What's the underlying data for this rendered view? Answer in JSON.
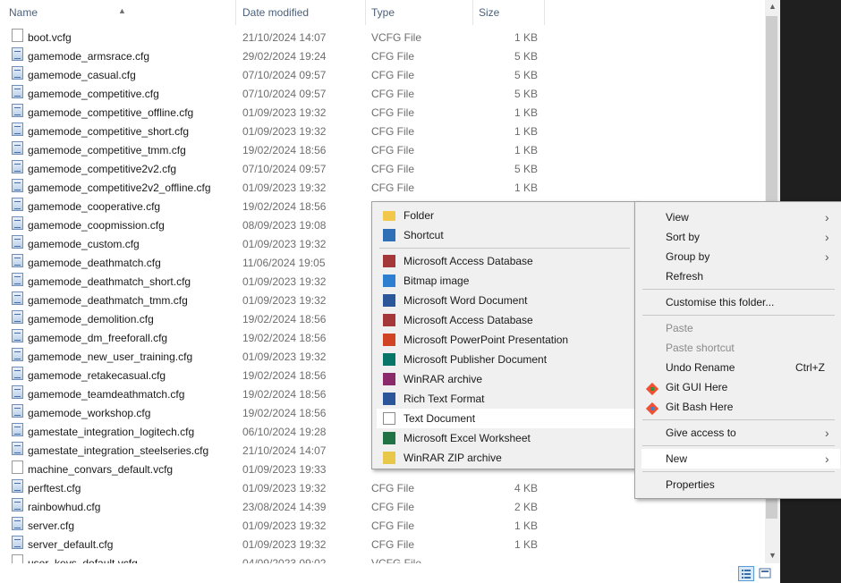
{
  "header": {
    "name": "Name",
    "date_modified": "Date modified",
    "type": "Type",
    "size": "Size"
  },
  "files": [
    {
      "name": "boot.vcfg",
      "date": "21/10/2024 14:07",
      "type": "VCFG File",
      "size": "1 KB",
      "icon": "vcfg-file-icon"
    },
    {
      "name": "gamemode_armsrace.cfg",
      "date": "29/02/2024 19:24",
      "type": "CFG File",
      "size": "5 KB",
      "icon": "cfg-file-icon"
    },
    {
      "name": "gamemode_casual.cfg",
      "date": "07/10/2024 09:57",
      "type": "CFG File",
      "size": "5 KB",
      "icon": "cfg-file-icon"
    },
    {
      "name": "gamemode_competitive.cfg",
      "date": "07/10/2024 09:57",
      "type": "CFG File",
      "size": "5 KB",
      "icon": "cfg-file-icon"
    },
    {
      "name": "gamemode_competitive_offline.cfg",
      "date": "01/09/2023 19:32",
      "type": "CFG File",
      "size": "1 KB",
      "icon": "cfg-file-icon"
    },
    {
      "name": "gamemode_competitive_short.cfg",
      "date": "01/09/2023 19:32",
      "type": "CFG File",
      "size": "1 KB",
      "icon": "cfg-file-icon"
    },
    {
      "name": "gamemode_competitive_tmm.cfg",
      "date": "19/02/2024 18:56",
      "type": "CFG File",
      "size": "1 KB",
      "icon": "cfg-file-icon"
    },
    {
      "name": "gamemode_competitive2v2.cfg",
      "date": "07/10/2024 09:57",
      "type": "CFG File",
      "size": "5 KB",
      "icon": "cfg-file-icon"
    },
    {
      "name": "gamemode_competitive2v2_offline.cfg",
      "date": "01/09/2023 19:32",
      "type": "CFG File",
      "size": "1 KB",
      "icon": "cfg-file-icon"
    },
    {
      "name": "gamemode_cooperative.cfg",
      "date": "19/02/2024 18:56",
      "type": "",
      "size": "",
      "icon": "cfg-file-icon"
    },
    {
      "name": "gamemode_coopmission.cfg",
      "date": "08/09/2023 19:08",
      "type": "",
      "size": "",
      "icon": "cfg-file-icon"
    },
    {
      "name": "gamemode_custom.cfg",
      "date": "01/09/2023 19:32",
      "type": "",
      "size": "",
      "icon": "cfg-file-icon"
    },
    {
      "name": "gamemode_deathmatch.cfg",
      "date": "11/06/2024 19:05",
      "type": "",
      "size": "",
      "icon": "cfg-file-icon"
    },
    {
      "name": "gamemode_deathmatch_short.cfg",
      "date": "01/09/2023 19:32",
      "type": "",
      "size": "",
      "icon": "cfg-file-icon"
    },
    {
      "name": "gamemode_deathmatch_tmm.cfg",
      "date": "01/09/2023 19:32",
      "type": "",
      "size": "",
      "icon": "cfg-file-icon"
    },
    {
      "name": "gamemode_demolition.cfg",
      "date": "19/02/2024 18:56",
      "type": "",
      "size": "",
      "icon": "cfg-file-icon"
    },
    {
      "name": "gamemode_dm_freeforall.cfg",
      "date": "19/02/2024 18:56",
      "type": "",
      "size": "",
      "icon": "cfg-file-icon"
    },
    {
      "name": "gamemode_new_user_training.cfg",
      "date": "01/09/2023 19:32",
      "type": "",
      "size": "",
      "icon": "cfg-file-icon"
    },
    {
      "name": "gamemode_retakecasual.cfg",
      "date": "19/02/2024 18:56",
      "type": "",
      "size": "",
      "icon": "cfg-file-icon"
    },
    {
      "name": "gamemode_teamdeathmatch.cfg",
      "date": "19/02/2024 18:56",
      "type": "",
      "size": "",
      "icon": "cfg-file-icon"
    },
    {
      "name": "gamemode_workshop.cfg",
      "date": "19/02/2024 18:56",
      "type": "",
      "size": "",
      "icon": "cfg-file-icon"
    },
    {
      "name": "gamestate_integration_logitech.cfg",
      "date": "06/10/2024 19:28",
      "type": "",
      "size": "",
      "icon": "cfg-file-icon"
    },
    {
      "name": "gamestate_integration_steelseries.cfg",
      "date": "21/10/2024 14:07",
      "type": "",
      "size": "",
      "icon": "cfg-file-icon"
    },
    {
      "name": "machine_convars_default.vcfg",
      "date": "01/09/2023 19:33",
      "type": "",
      "size": "",
      "icon": "vcfg-file-icon"
    },
    {
      "name": "perftest.cfg",
      "date": "01/09/2023 19:32",
      "type": "CFG File",
      "size": "4 KB",
      "icon": "cfg-file-icon"
    },
    {
      "name": "rainbowhud.cfg",
      "date": "23/08/2024 14:39",
      "type": "CFG File",
      "size": "2 KB",
      "icon": "cfg-file-icon"
    },
    {
      "name": "server.cfg",
      "date": "01/09/2023 19:32",
      "type": "CFG File",
      "size": "1 KB",
      "icon": "cfg-file-icon"
    },
    {
      "name": "server_default.cfg",
      "date": "01/09/2023 19:32",
      "type": "CFG File",
      "size": "1 KB",
      "icon": "cfg-file-icon"
    },
    {
      "name": "user_keys_default.vcfg",
      "date": "04/09/2023 09:02",
      "type": "VCFG File",
      "size": "",
      "icon": "vcfg-file-icon"
    }
  ],
  "new_submenu": {
    "items": [
      {
        "label": "Folder",
        "icon": "folder-icon",
        "color": "#f2c84b"
      },
      {
        "label": "Shortcut",
        "icon": "shortcut-icon",
        "color": "#2f6fb5"
      },
      {
        "label": "Microsoft Access Database",
        "icon": "access-icon",
        "color": "#a4373a"
      },
      {
        "label": "Bitmap image",
        "icon": "bitmap-icon",
        "color": "#2f7fd0"
      },
      {
        "label": "Microsoft Word Document",
        "icon": "word-icon",
        "color": "#2b579a"
      },
      {
        "label": "Microsoft Access Database",
        "icon": "access-icon",
        "color": "#a4373a"
      },
      {
        "label": "Microsoft PowerPoint Presentation",
        "icon": "powerpoint-icon",
        "color": "#d04423"
      },
      {
        "label": "Microsoft Publisher Document",
        "icon": "publisher-icon",
        "color": "#077568"
      },
      {
        "label": "WinRAR archive",
        "icon": "winrar-icon",
        "color": "#8b2a6b"
      },
      {
        "label": "Rich Text Format",
        "icon": "rtf-icon",
        "color": "#2b579a"
      },
      {
        "label": "Text Document",
        "icon": "text-document-icon",
        "color": "#ffffff"
      },
      {
        "label": "Microsoft Excel Worksheet",
        "icon": "excel-icon",
        "color": "#217346"
      },
      {
        "label": "WinRAR ZIP archive",
        "icon": "winrar-zip-icon",
        "color": "#e8c84a"
      }
    ]
  },
  "context_menu": {
    "view": "View",
    "sort_by": "Sort by",
    "group_by": "Group by",
    "refresh": "Refresh",
    "customise": "Customise this folder...",
    "paste": "Paste",
    "paste_shortcut": "Paste shortcut",
    "undo_rename": "Undo Rename",
    "undo_shortcut": "Ctrl+Z",
    "git_gui": "Git GUI Here",
    "git_bash": "Git Bash Here",
    "give_access": "Give access to",
    "new": "New",
    "properties": "Properties"
  },
  "colors": {
    "header_text": "#4c607a",
    "menu_bg": "#f0f0f0",
    "highlight": "#ffffff",
    "git_orange": "#f05133"
  }
}
